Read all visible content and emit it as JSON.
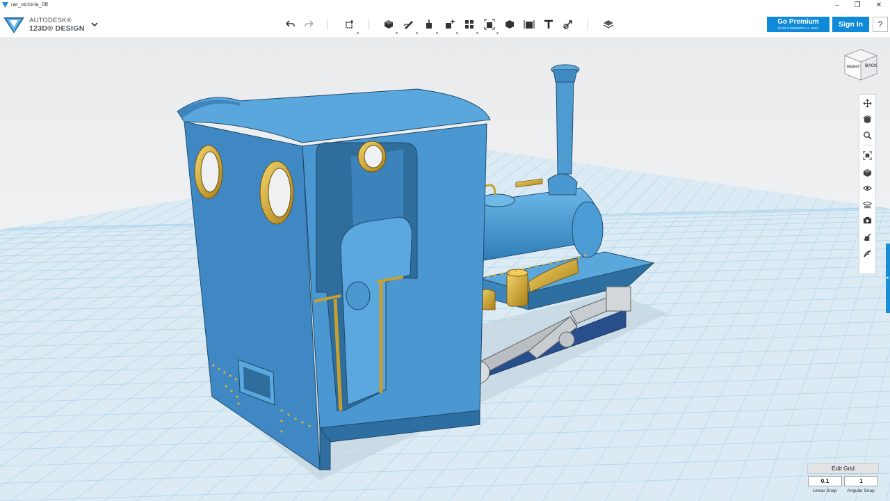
{
  "window": {
    "title": "rar_victoria_08",
    "controls": {
      "minimize": "–",
      "maximize": "❐",
      "close": "✕"
    }
  },
  "brand": {
    "line1": "AUTODESK®",
    "line2": "123D® DESIGN",
    "accent_color": "#1a8fd6"
  },
  "toolbar": {
    "icons": [
      "undo-icon",
      "redo-icon",
      "transform-icon",
      "primitives-icon",
      "sketch-icon",
      "construct-icon",
      "modify-icon",
      "pattern-icon",
      "group-icon",
      "combine-icon",
      "measure-icon",
      "text-icon",
      "snap-icon",
      "materials-icon"
    ]
  },
  "account": {
    "premium_label": "Go Premium",
    "premium_sub": "(FOR COMMERCIAL USE)",
    "signin_label": "Sign In",
    "help_label": "?",
    "button_color": "#0e8ad8"
  },
  "viewcube": {
    "right": "RIGHT",
    "back": "BACK"
  },
  "navbar": {
    "icons": [
      "pan-icon",
      "orbit-icon",
      "zoom-icon",
      "fit-icon",
      "view-icon",
      "visibility-icon",
      "materials-outlines-icon",
      "camera-icon",
      "hide-sketches-icon",
      "hide-meshes-icon"
    ]
  },
  "grid": {
    "edit_label": "Edit Grid",
    "linear_snap_value": "0.1",
    "angular_snap_value": "1",
    "linear_snap_label": "Linear Snap",
    "angular_snap_label": "Angular Snap"
  },
  "scene": {
    "model_color": "#4f9fd6",
    "brass_color": "#d9b33a",
    "grid_color": "#a6d3ec"
  }
}
